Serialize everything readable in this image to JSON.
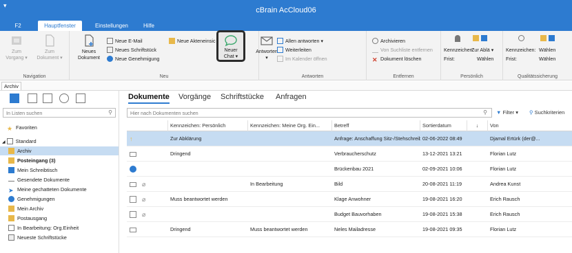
{
  "window": {
    "title": "cBrain AcCloud06",
    "system_menu": "▾"
  },
  "ribbon_tabs": [
    "F2",
    "Hauptfenster",
    "Einstellungen",
    "Hilfe"
  ],
  "ribbon": {
    "navigation": {
      "zum_vorgang": "Zum\nVorgang ▾",
      "zum_dokument": "Zum\nDokument ▾",
      "label": "Navigation"
    },
    "neu": {
      "neues_dokument": "Neues\nDokument",
      "neue_email": "Neue E-Mail",
      "neues_schriftstueck": "Neues Schriftstück",
      "neue_genehmigung": "Neue Genehmigung",
      "neue_akteneinsicht": "Neue Akteneinsic",
      "neuer_chat": "Neuer\nChat ▾",
      "label": "Neu"
    },
    "antworten": {
      "antworten": "Antworten\n▾",
      "allen_antworten": "Allen antworten ▾",
      "weiterleiten": "Weiterleiten",
      "im_kalender": "Im Kalender öffnen",
      "label": "Antworten"
    },
    "entfernen": {
      "archivieren": "Archivieren",
      "von_suchliste": "Von Suchliste entfernen",
      "dokument_loeschen": "Dokument löschen",
      "label": "Entfernen"
    },
    "persoenlich": {
      "kennzeichen": "Kennzeichen:",
      "frist": "Frist:",
      "zur_ablage": "Zur Ablä ▾",
      "waehlen": "Wählen",
      "label": "Persönlich"
    },
    "qualitaet": {
      "kennzeichen": "Kennzeichen:",
      "waehlen1": "Wählen",
      "frist": "Frist:",
      "waehlen2": "Wählen",
      "label": "Qualitätssicherung"
    }
  },
  "archiv_tab": "Archiv",
  "left": {
    "search_placeholder": "In Listen suchen",
    "tree": [
      "Favoriten",
      "Standard",
      "Archiv",
      "Posteingang (3)",
      "Mein Schreibtisch",
      "Gesendete Dokumente",
      "Meine gechatteten Dokumente",
      "Genehmigungen",
      "Mein Archiv",
      "Postausgang",
      "In Bearbeitung: Org.Einheit",
      "Neueste Schriftstücke"
    ]
  },
  "main": {
    "tabs": [
      "Dokumente",
      "Vorgänge",
      "Schriftstücke",
      "Anfragen"
    ],
    "search_placeholder": "Hier nach Dokumenten suchen",
    "filter": "Filter ▾",
    "suchkriterien": "Suchkriterien",
    "columns": [
      "Kennzeichen: Persönlich",
      "Kennzeichen: Meine Org. Ein...",
      "Betreff",
      "Sortierdatum",
      "↓",
      "Von"
    ],
    "rows": [
      {
        "k1": "Zur Abklärung",
        "k2": "",
        "betreff": "Anfrage: Anschaffung Sitz-/Stehschreibtische",
        "datum": "02-06-2022 08:49",
        "von": "Djamal Ertürk (der@..."
      },
      {
        "k1": "Dringend",
        "k2": "",
        "betreff": "Verbraucherschutz",
        "datum": "13-12-2021 13:21",
        "von": "Florian Lutz"
      },
      {
        "k1": "",
        "k2": "",
        "betreff": "Brückenbau 2021",
        "datum": "02-09-2021 10:06",
        "von": "Florian Lutz"
      },
      {
        "k1": "",
        "k2": "In Bearbeitung",
        "betreff": "Bild",
        "datum": "20-08-2021 11:19",
        "von": "Andrea Kunst"
      },
      {
        "k1": "Muss beantwortet werden",
        "k2": "",
        "betreff": "Klage Anwohner",
        "datum": "19-08-2021 16:20",
        "von": "Erich Rausch"
      },
      {
        "k1": "",
        "k2": "",
        "betreff": "Budget Bauvorhaben",
        "datum": "19-08-2021 15:38",
        "von": "Erich Rausch"
      },
      {
        "k1": "Dringend",
        "k2": "Muss beantwortet werden",
        "betreff": "Neles Mailadresse",
        "datum": "19-08-2021 09:35",
        "von": "Florian Lutz"
      }
    ]
  },
  "colors": {
    "accent": "#2d7bd0",
    "selection": "#c6dcf2",
    "chat_highlight": "#2b2b2b"
  }
}
